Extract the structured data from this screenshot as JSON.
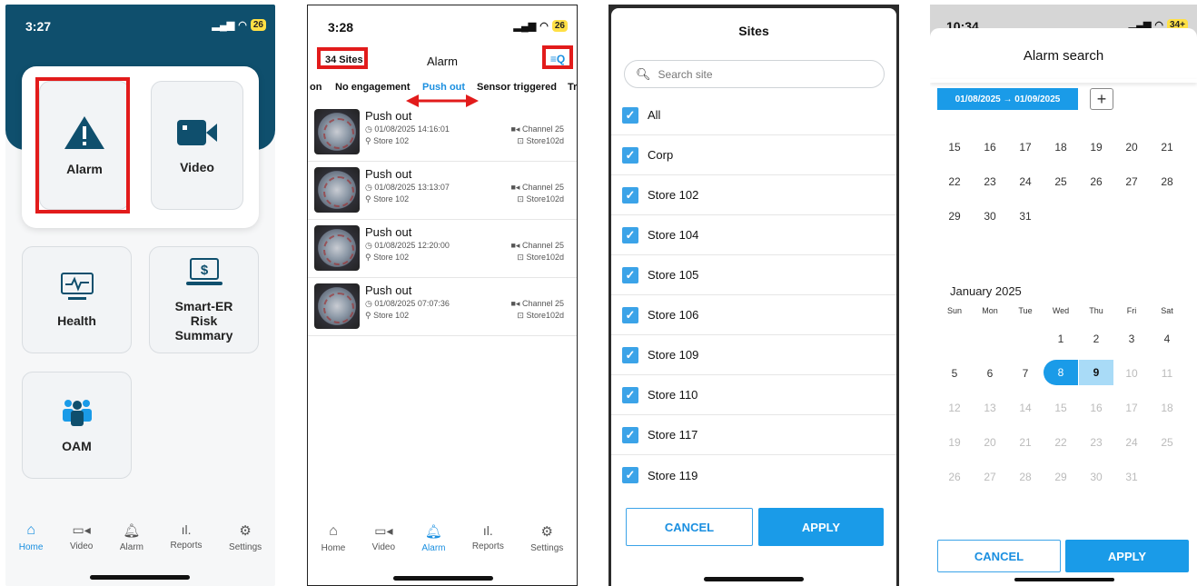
{
  "screen1": {
    "status": {
      "time": "3:27",
      "battery": "26"
    },
    "tiles": {
      "alarm": "Alarm",
      "video": "Video",
      "health": "Health",
      "smart_er": "Smart-ER Risk Summary",
      "oam": "OAM"
    },
    "tabbar": [
      {
        "label": "Home",
        "icon": "home-icon",
        "active": true
      },
      {
        "label": "Video",
        "icon": "video-icon",
        "active": false
      },
      {
        "label": "Alarm",
        "icon": "bell-icon",
        "active": false
      },
      {
        "label": "Reports",
        "icon": "bar-chart-icon",
        "active": false
      },
      {
        "label": "Settings",
        "icon": "gear-icon",
        "active": false
      }
    ]
  },
  "screen2": {
    "status": {
      "time": "3:28",
      "battery": "26"
    },
    "sites_label": "34 Sites",
    "title": "Alarm",
    "chips": [
      "on",
      "No engagement",
      "Push out",
      "Sensor triggered",
      "Tr"
    ],
    "active_chip": "Push out",
    "alarms": [
      {
        "title": "Push out",
        "time": "01/08/2025 14:16:01",
        "store": "Store 102",
        "channel": "Channel 25",
        "device": "Store102d"
      },
      {
        "title": "Push out",
        "time": "01/08/2025 13:13:07",
        "store": "Store 102",
        "channel": "Channel 25",
        "device": "Store102d"
      },
      {
        "title": "Push out",
        "time": "01/08/2025 12:20:00",
        "store": "Store 102",
        "channel": "Channel 25",
        "device": "Store102d"
      },
      {
        "title": "Push out",
        "time": "01/08/2025 07:07:36",
        "store": "Store 102",
        "channel": "Channel 25",
        "device": "Store102d"
      }
    ],
    "tabbar": [
      {
        "label": "Home",
        "icon": "home-icon",
        "active": false
      },
      {
        "label": "Video",
        "icon": "video-icon",
        "active": false
      },
      {
        "label": "Alarm",
        "icon": "bell-icon",
        "active": true
      },
      {
        "label": "Reports",
        "icon": "bar-chart-icon",
        "active": false
      },
      {
        "label": "Settings",
        "icon": "gear-icon",
        "active": false
      }
    ]
  },
  "screen3": {
    "title": "Sites",
    "search_placeholder": "Search site",
    "sites": [
      "All",
      "Corp",
      "Store 102",
      "Store 104",
      "Store 105",
      "Store 106",
      "Store 109",
      "Store 110",
      "Store 117",
      "Store 119"
    ],
    "cancel": "CANCEL",
    "apply": "APPLY"
  },
  "screen4": {
    "status": {
      "time": "10:34",
      "battery": "34+"
    },
    "title": "Alarm search",
    "date_range": "01/08/2025 → 01/09/2025",
    "prev_month_rows": [
      [
        "15",
        "16",
        "17",
        "18",
        "19",
        "20",
        "21"
      ],
      [
        "22",
        "23",
        "24",
        "25",
        "26",
        "27",
        "28"
      ],
      [
        "29",
        "30",
        "31"
      ]
    ],
    "month_title": "January 2025",
    "weekdays": [
      "Sun",
      "Mon",
      "Tue",
      "Wed",
      "Thu",
      "Fri",
      "Sat"
    ],
    "month_rows": [
      [
        "",
        "",
        "",
        "1",
        "2",
        "3",
        "4"
      ],
      [
        "5",
        "6",
        "7",
        "8",
        "9",
        "10",
        "11"
      ],
      [
        "12",
        "13",
        "14",
        "15",
        "16",
        "17",
        "18"
      ],
      [
        "19",
        "20",
        "21",
        "22",
        "23",
        "24",
        "25"
      ],
      [
        "26",
        "27",
        "28",
        "29",
        "30",
        "31",
        ""
      ]
    ],
    "range_start": "8",
    "range_end": "9",
    "cancel": "CANCEL",
    "apply": "APPLY"
  }
}
